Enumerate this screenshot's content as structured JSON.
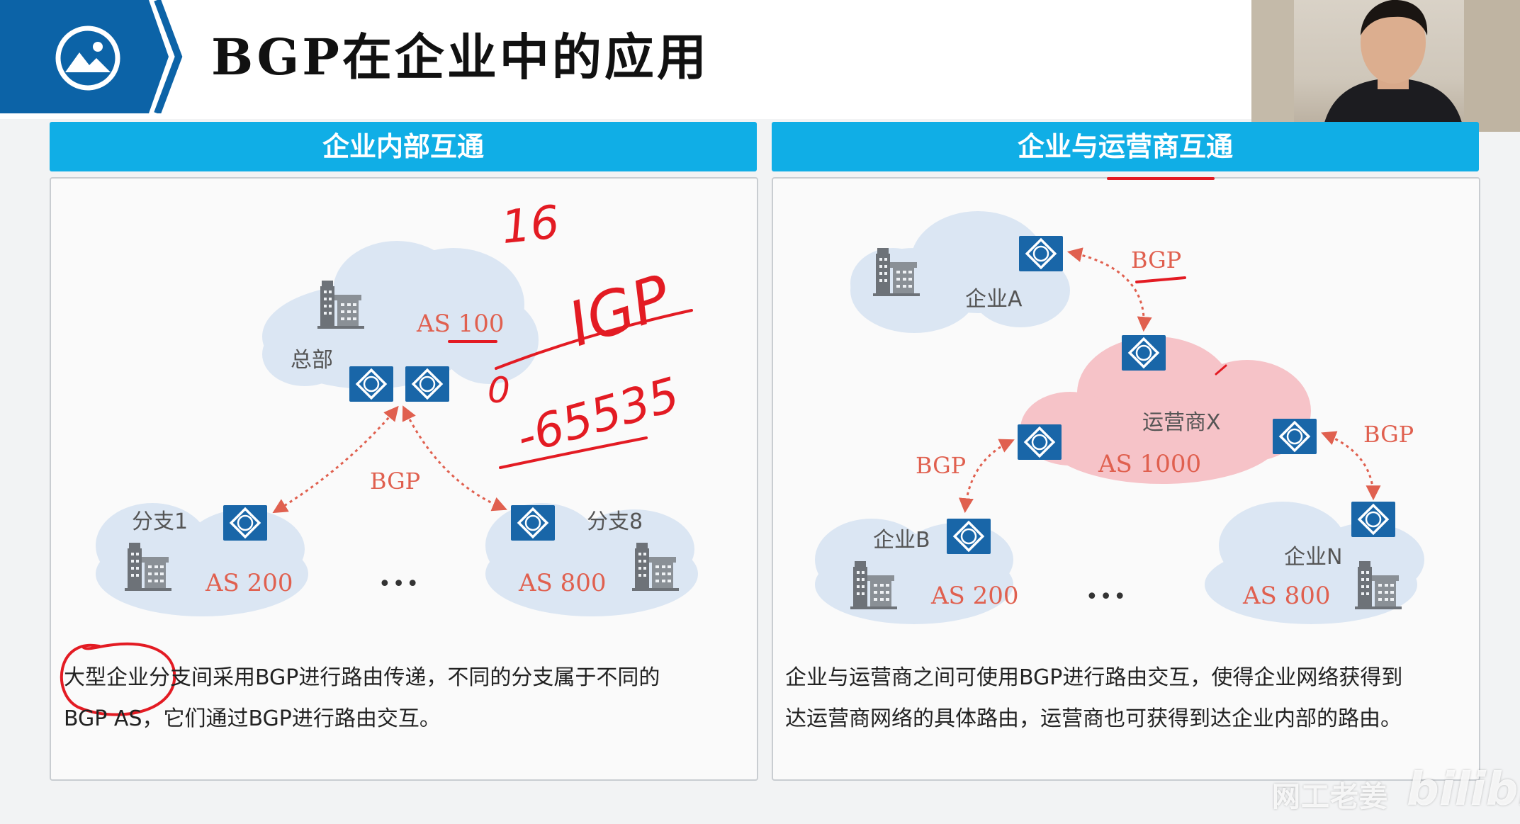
{
  "slide": {
    "title": "BGP在企业中的应用"
  },
  "left_panel": {
    "header": "企业内部互通",
    "hq_label": "总部",
    "hq_as": "AS 100",
    "branch1_label": "分支1",
    "branch1_as": "AS 200",
    "branch8_label": "分支8",
    "branch8_as": "AS 800",
    "link_label": "BGP",
    "ellipsis": "•••",
    "caption_line1": "大型企业分支间采用BGP进行路由传递，不同的分支属于不同的",
    "caption_line2": "BGP AS，它们通过BGP进行路由交互。"
  },
  "right_panel": {
    "header": "企业与运营商互通",
    "enterprise_a_label": "企业A",
    "isp_label": "运营商X",
    "isp_as": "AS 1000",
    "enterprise_b_label": "企业B",
    "enterprise_b_as": "AS 200",
    "enterprise_n_label": "企业N",
    "enterprise_n_as": "AS 800",
    "link_label_top": "BGP",
    "link_label_left": "BGP",
    "link_label_right": "BGP",
    "ellipsis": "•••",
    "caption_line1": "企业与运营商之间可使用BGP进行路由交互，使得企业网络获得到",
    "caption_line2": "达运营商网络的具体路由，运营商也可获得到达企业内部的路由。"
  },
  "annotations": {
    "text_16": "16",
    "text_igp": "IGP",
    "text_0": "0",
    "text_range": "-65535"
  },
  "router_glyph": "R",
  "watermark": {
    "channel": "网工老姜",
    "site_logo": "bilibili"
  },
  "colors": {
    "header_blue": "#10aee6",
    "router_blue": "#1966a8",
    "cloud_blue": "#dbe6f3",
    "cloud_pink": "#f6c3c8",
    "as_red": "#e0604f",
    "pen_red": "#e31b23"
  }
}
